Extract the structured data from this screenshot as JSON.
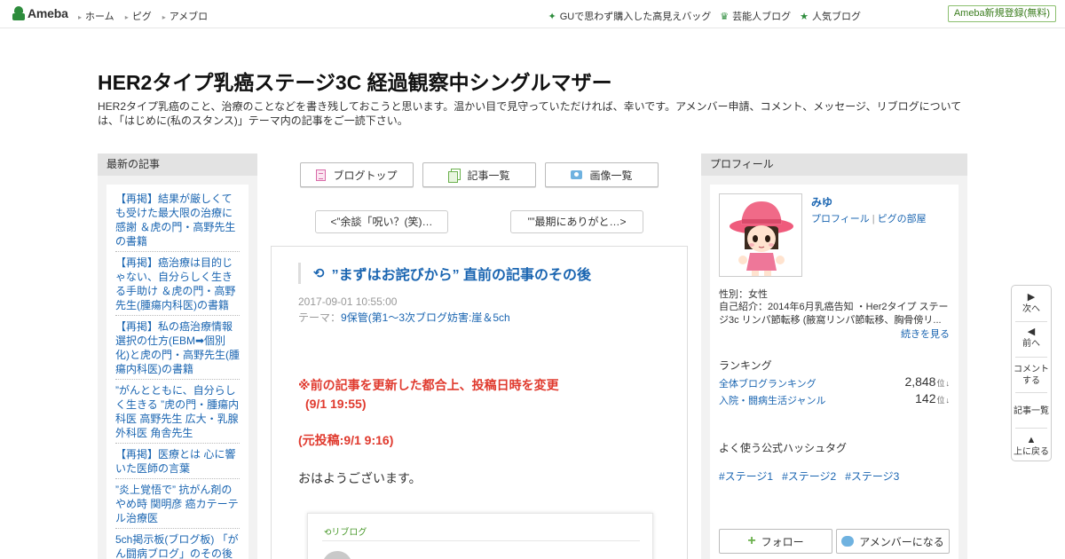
{
  "topbar": {
    "logo_text": "Ameba",
    "nav": [
      "ホーム",
      "ピグ",
      "アメブロ"
    ],
    "right_links": [
      {
        "icon": "sparkle-icon",
        "glyph": "✦",
        "label": "GUで思わず購入した高見えバッグ"
      },
      {
        "icon": "crown-icon",
        "glyph": "♛",
        "label": "芸能人ブログ"
      },
      {
        "icon": "star-icon",
        "glyph": "★",
        "label": "人気ブログ"
      }
    ],
    "register_label": "Ameba新規登録(無料)"
  },
  "header": {
    "title": "HER2タイプ乳癌ステージ3C 経過観察中シングルマザー",
    "description": "HER2タイプ乳癌のこと、治療のことなどを書き残しておこうと思います。温かい目で見守っていただければ、幸いです。アメンバー申請、コメント、メッセージ、リブログについては、「はじめに(私のスタンス)」テーマ内の記事をご一読下さい。"
  },
  "left": {
    "heading": "最新の記事",
    "items": [
      "【再掲】結果が厳しくても受けた最大限の治療に感謝 ＆虎の門・高野先生の書籍",
      "【再掲】癌治療は目的じゃない、自分らしく生きる手助け ＆虎の門・高野先生(腫瘍内科医)の書籍",
      "【再掲】私の癌治療情報選択の仕方(EBM➡個別化)と虎の門・高野先生(腫瘍内科医)の書籍",
      "”がんとともに、自分らしく生きる ”虎の門・腫瘍内科医 高野先生 広大・乳腺外科医 角舎先生",
      "【再掲】医療とは 心に響いた医師の言葉",
      "”炎上覚悟で” 抗がん剤のやめ時 関明彦 癌カテーテル治療医",
      "5ch掲示板(ブログ板) 「がん闘病ブログ」のその後"
    ]
  },
  "center": {
    "nav_buttons": [
      {
        "icon": "blog-top-icon",
        "label": "ブログトップ"
      },
      {
        "icon": "article-list-icon",
        "label": "記事一覧"
      },
      {
        "icon": "image-list-icon",
        "label": "画像一覧"
      }
    ],
    "prev_label": "<”余談「呪い？(笑)…",
    "next_label": "””最期にありがと…>",
    "article": {
      "title": "”まずはお詫びから” 直前の記事のその後",
      "date": "2017-09-01 10:55:00",
      "theme_prefix": "テーマ：",
      "theme": "9保管(第1～3次ブログ妨害:崖＆5ch",
      "notice_line1": "※前の記事を更新した都合上、投稿日時を変更",
      "notice_line2": "(9/1  19:55)",
      "notice_line3": "(元投稿:9/1  9:16)",
      "greeting": "おはようございます。",
      "reblog_label": "リブログ"
    }
  },
  "right": {
    "heading": "プロフィール",
    "name": "みゆ",
    "link_profile": "プロフィール",
    "link_separator": "|",
    "link_pigg": "ピグの部屋",
    "gender": "性別：女性",
    "intro": "自己紹介：2014年6月乳癌告知 ・Her2タイプ ステージ3c リンパ節転移 (腋窩リンパ節転移、胸骨傍リ...",
    "more": "続きを見る",
    "ranking_heading": "ランキング",
    "rankings": [
      {
        "label": "全体ブログランキング",
        "value": "2,848",
        "unit": "位",
        "arrow": "↓"
      },
      {
        "label": "入院・闘病生活ジャンル",
        "value": "142",
        "unit": "位",
        "arrow": "↓"
      }
    ],
    "hashtag_heading": "よく使う公式ハッシュタグ",
    "hashtags": [
      "#ステージ1",
      "#ステージ2",
      "#ステージ3"
    ],
    "follow_label": "フォロー",
    "member_label": "アメンバーになる"
  },
  "float_nav": {
    "next": "次へ",
    "prev": "前へ",
    "comment_line1": "コメント",
    "comment_line2": "する",
    "list": "記事一覧",
    "top": "上に戻る"
  },
  "colors": {
    "link": "#1a65b1",
    "brand_green": "#2d8c3c",
    "notice_red": "#e03a2e"
  }
}
